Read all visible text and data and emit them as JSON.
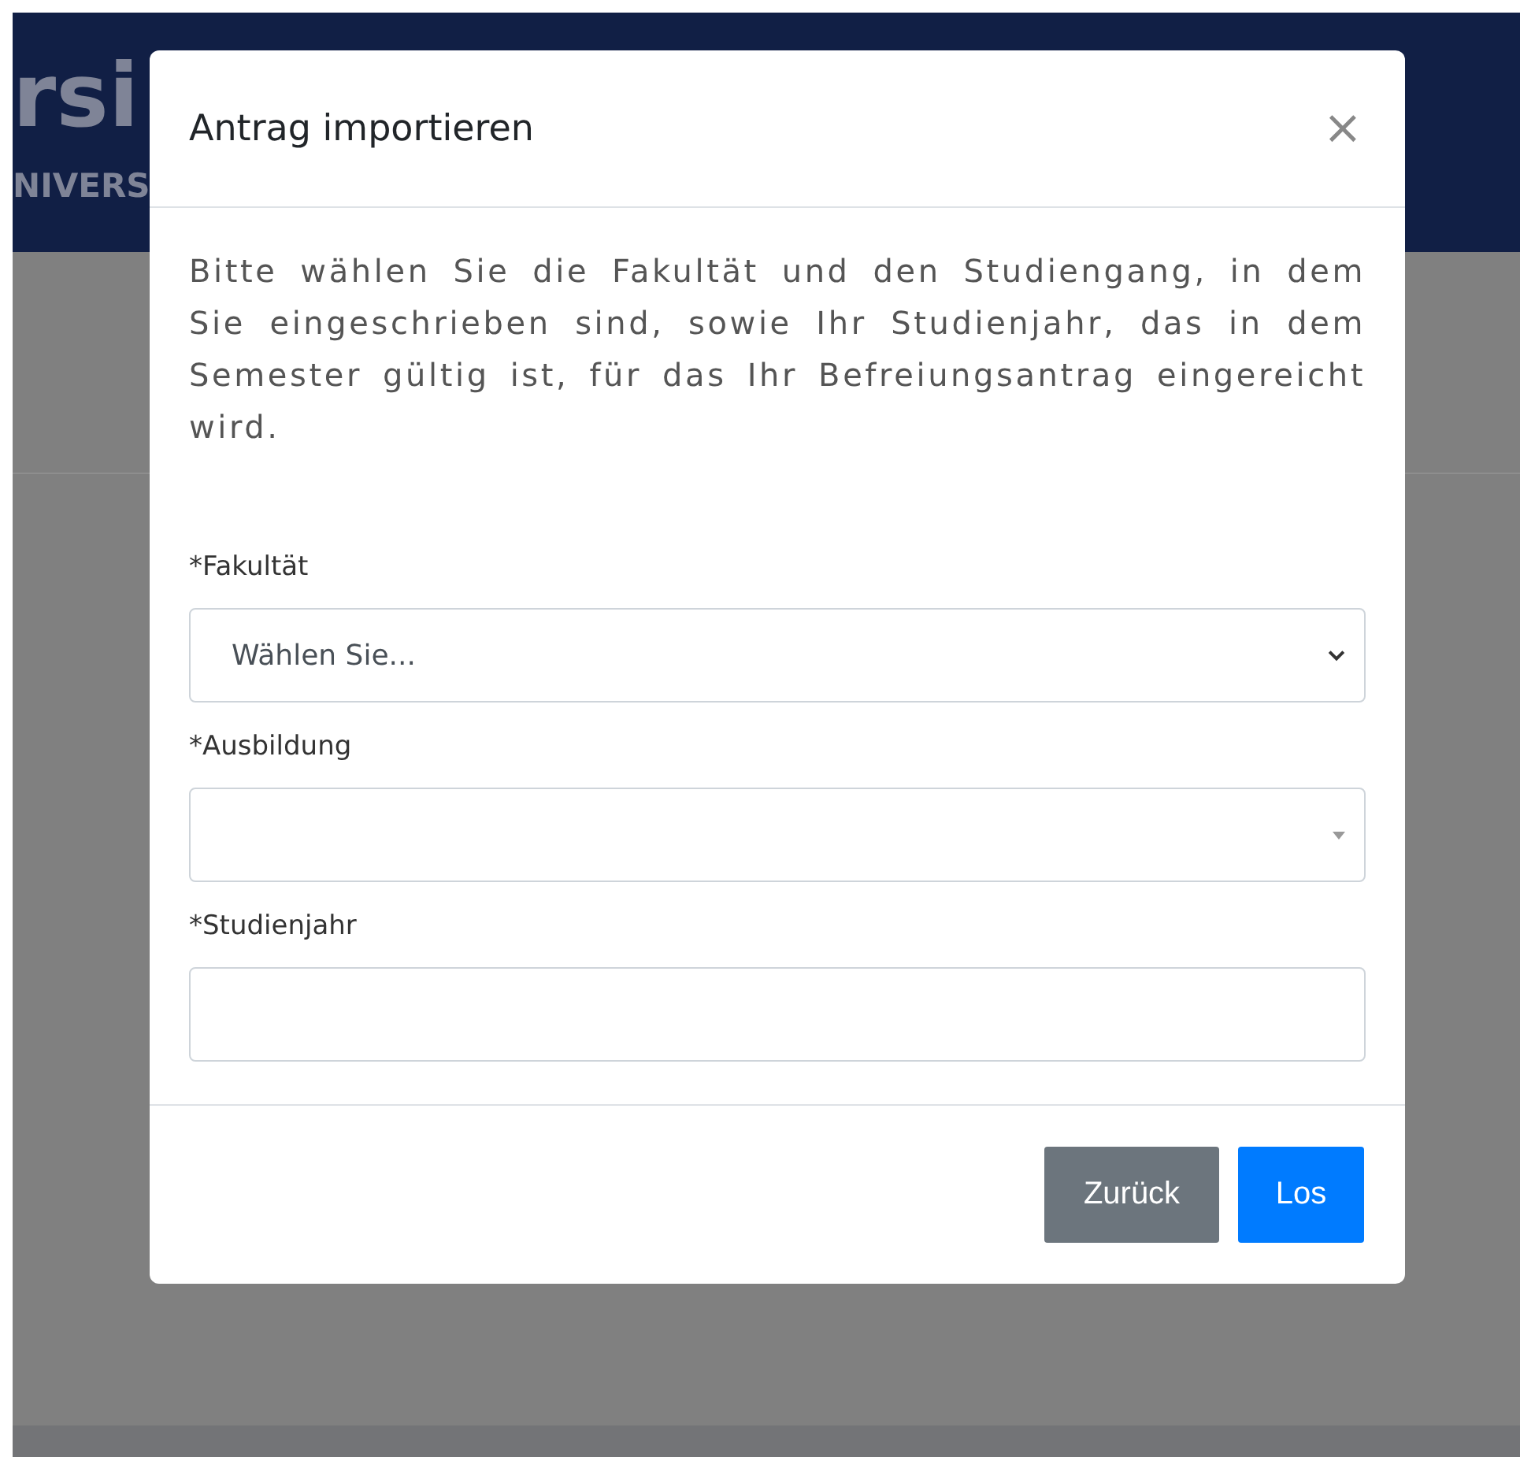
{
  "background": {
    "logo_text": "rsi",
    "logo_subtitle": "NIVERS"
  },
  "modal": {
    "title": "Antrag importieren",
    "close": "×",
    "description": "Bitte wählen Sie die Fakultät und den Studiengang, in dem Sie eingeschrieben sind, sowie Ihr Studienjahr, das in dem Semester gültig ist, für das Ihr Befreiungsantrag eingereicht wird.",
    "fields": [
      {
        "kind": "select",
        "label": "*Fakultät",
        "value": "Wählen Sie..."
      },
      {
        "kind": "combobox",
        "label": "*Ausbildung"
      },
      {
        "kind": "text",
        "label": "*Studienjahr"
      }
    ],
    "buttons": [
      {
        "kind": "secondary",
        "label": "Zurück"
      },
      {
        "kind": "primary",
        "label": "Los"
      }
    ]
  }
}
